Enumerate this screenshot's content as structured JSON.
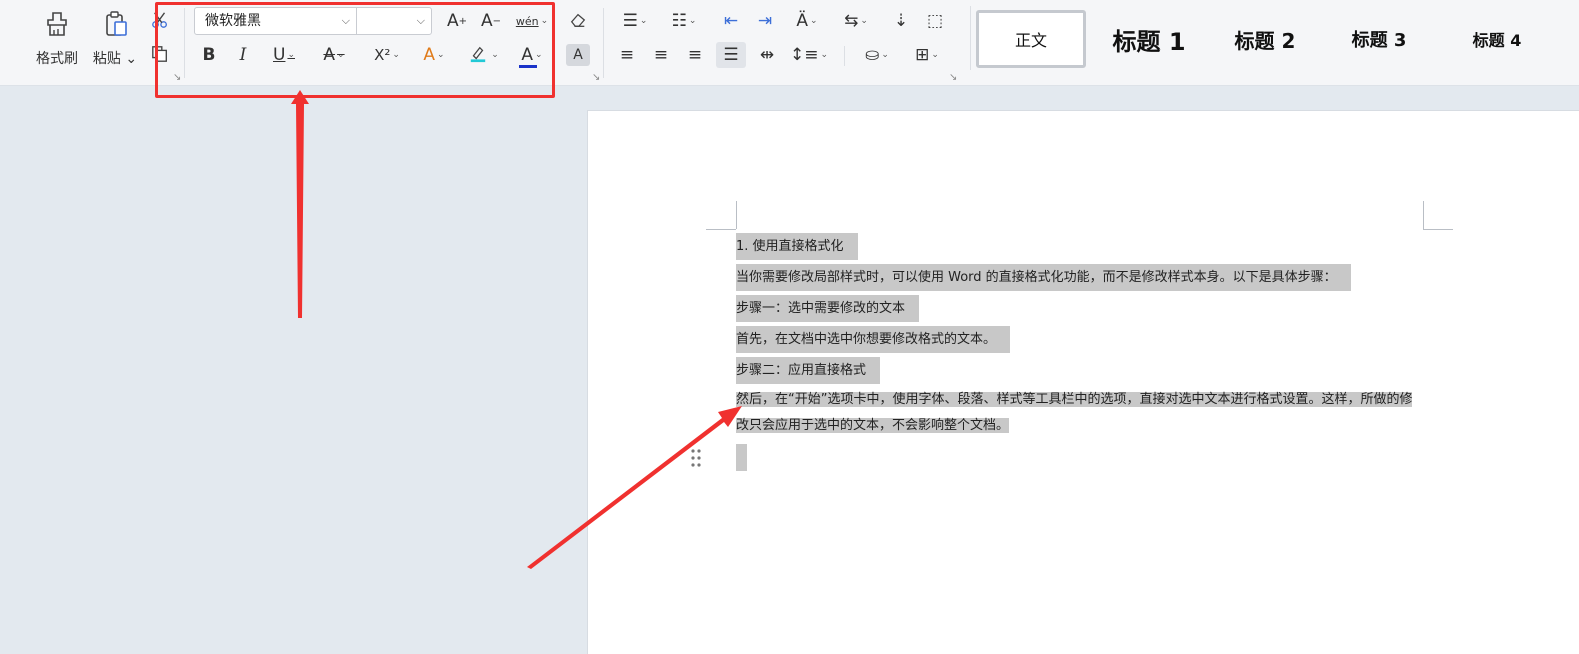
{
  "ribbon": {
    "format_painter_label": "格式刷",
    "paste_label": "粘贴",
    "font_name": "微软雅黑",
    "font_size": "",
    "styles": [
      {
        "label": "正文"
      },
      {
        "label": "标题 1"
      },
      {
        "label": "标题 2"
      },
      {
        "label": "标题 3"
      },
      {
        "label": "标题 4"
      }
    ],
    "glyphs": {
      "bold": "B",
      "italic": "I",
      "underline": "U",
      "strike": "A",
      "superscript": "X²",
      "text_effect": "A",
      "font_color": "A",
      "char_shading": "A",
      "grow_font": "A",
      "shrink_font": "A",
      "phonetic": "wén"
    },
    "colors": {
      "highlight": "#22c9d6",
      "font_color": "#1a33c9",
      "accent_red": "#f0312f"
    }
  },
  "document": {
    "paragraphs": [
      "1. 使用直接格式化",
      "当你需要修改局部样式时，可以使用 Word 的直接格式化功能，而不是修改样式本身。以下是具体步骤：",
      "步骤一：选中需要修改的文本",
      "首先，在文档中选中你想要修改格式的文本。",
      "步骤二：应用直接格式",
      "然后，在“开始”选项卡中，使用字体、段落、样式等工具栏中的选项，直接对选中文本进行格式设置。这样，所做的修改只会应用于选中的文本，不会影响整个文档。"
    ]
  }
}
